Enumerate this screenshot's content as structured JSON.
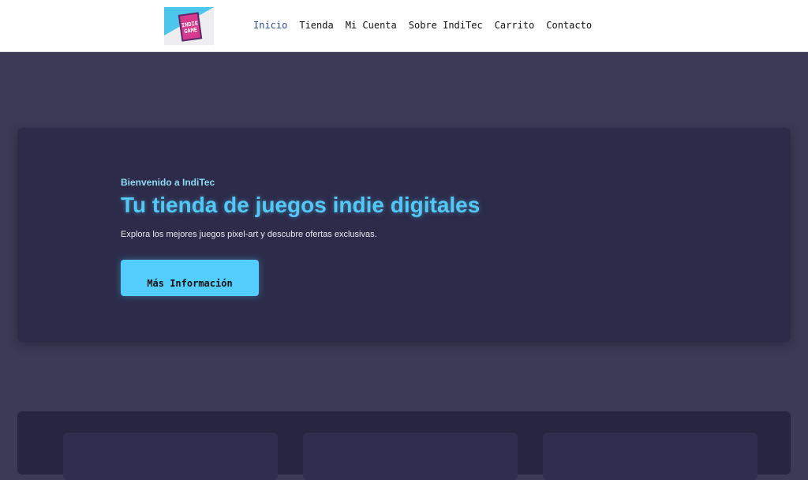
{
  "header": {
    "logo_text": "INDIE GAME",
    "nav": [
      {
        "label": "Inicio",
        "active": true
      },
      {
        "label": "Tienda"
      },
      {
        "label": "Mi Cuenta"
      },
      {
        "label": "Sobre IndiTec"
      },
      {
        "label": "Carrito"
      },
      {
        "label": "Contacto"
      }
    ]
  },
  "hero": {
    "kicker": "Bienvenido a IndiTec",
    "title": "Tu tienda de juegos indie digitales",
    "subtitle": "Explora los mejores juegos pixel-art y descubre ofertas exclusivas.",
    "button": "Más Información"
  },
  "colors": {
    "accent": "#53cdfb",
    "background": "#3d3a58",
    "panel": "#2d2b4a"
  }
}
